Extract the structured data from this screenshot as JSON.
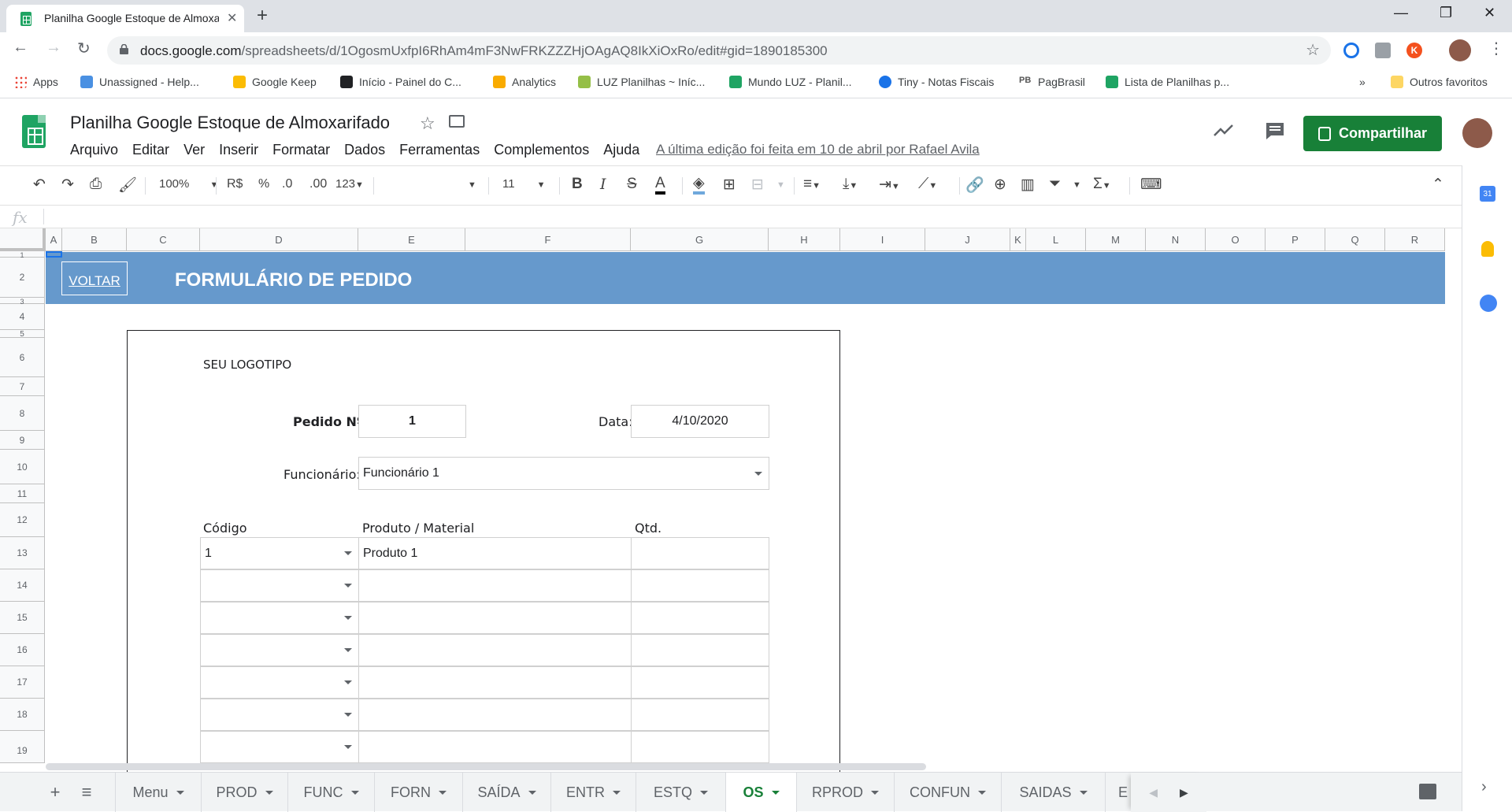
{
  "browser": {
    "tab_title": "Planilha Google Estoque de Almoxarifado",
    "url_host": "docs.google.com",
    "url_path": "/spreadsheets/d/1OgosmUxfpI6RhAm4mF3NwFRKZZZHjOAgAQ8IkXiOxRo/edit#gid=1890185300",
    "bookmarks": [
      "Apps",
      "Unassigned - Help...",
      "Google Keep",
      "Início - Painel do C...",
      "Analytics",
      "LUZ Planilhas ~ Iníc...",
      "Mundo LUZ - Planil...",
      "Tiny - Notas Fiscais",
      "PagBrasil",
      "Lista de Planilhas p..."
    ],
    "overflow": "»",
    "other_bookmarks": "Outros favoritos",
    "ext_k": "K"
  },
  "doc": {
    "title": "Planilha Google Estoque de Almoxarifado",
    "menus": [
      "Arquivo",
      "Editar",
      "Ver",
      "Inserir",
      "Formatar",
      "Dados",
      "Ferramentas",
      "Complementos",
      "Ajuda"
    ],
    "last_edit": "A última edição foi feita em 10 de abril por Rafael Avila",
    "share": "Compartilhar"
  },
  "toolbar": {
    "zoom": "100%",
    "currency": "R$",
    "percent": "%",
    "dec_less": ".0",
    "dec_more": ".00",
    "format_more": "123",
    "font_size": "11"
  },
  "formula_bar": {
    "fx": "fx"
  },
  "grid": {
    "columns": [
      "A",
      "B",
      "C",
      "D",
      "E",
      "F",
      "G",
      "H",
      "I",
      "J",
      "K",
      "L",
      "M",
      "N",
      "O",
      "P",
      "Q",
      "R"
    ],
    "rows": [
      "1",
      "2",
      "3",
      "4",
      "5",
      "6",
      "7",
      "8",
      "9",
      "10",
      "11",
      "12",
      "13",
      "14",
      "15",
      "16",
      "17",
      "18",
      "19"
    ]
  },
  "form": {
    "back": "VOLTAR",
    "title": "FORMULÁRIO DE PEDIDO",
    "logo": "SEU LOGOTIPO",
    "order_label": "Pedido Nº",
    "order_number": "1",
    "date_label": "Data:",
    "date_value": "4/10/2020",
    "employee_label": "Funcionário:",
    "employee_value": "Funcionário 1",
    "col_code": "Código",
    "col_product": "Produto / Material",
    "col_qty": "Qtd.",
    "rows": [
      {
        "code": "1",
        "product": "Produto 1",
        "qty": ""
      },
      {
        "code": "",
        "product": "",
        "qty": ""
      },
      {
        "code": "",
        "product": "",
        "qty": ""
      },
      {
        "code": "",
        "product": "",
        "qty": ""
      },
      {
        "code": "",
        "product": "",
        "qty": ""
      },
      {
        "code": "",
        "product": "",
        "qty": ""
      },
      {
        "code": "",
        "product": "",
        "qty": ""
      }
    ]
  },
  "sheets": {
    "add": "+",
    "list_icon": "≡",
    "tabs": [
      "Menu",
      "PROD",
      "FUNC",
      "FORN",
      "SAÍDA",
      "ENTR",
      "ESTQ",
      "OS",
      "RPROD",
      "CONFUN",
      "SAIDAS",
      "E"
    ],
    "active": "OS"
  },
  "colors": {
    "banner": "#6699cc",
    "share": "#188038",
    "active_tab": "#188038"
  }
}
